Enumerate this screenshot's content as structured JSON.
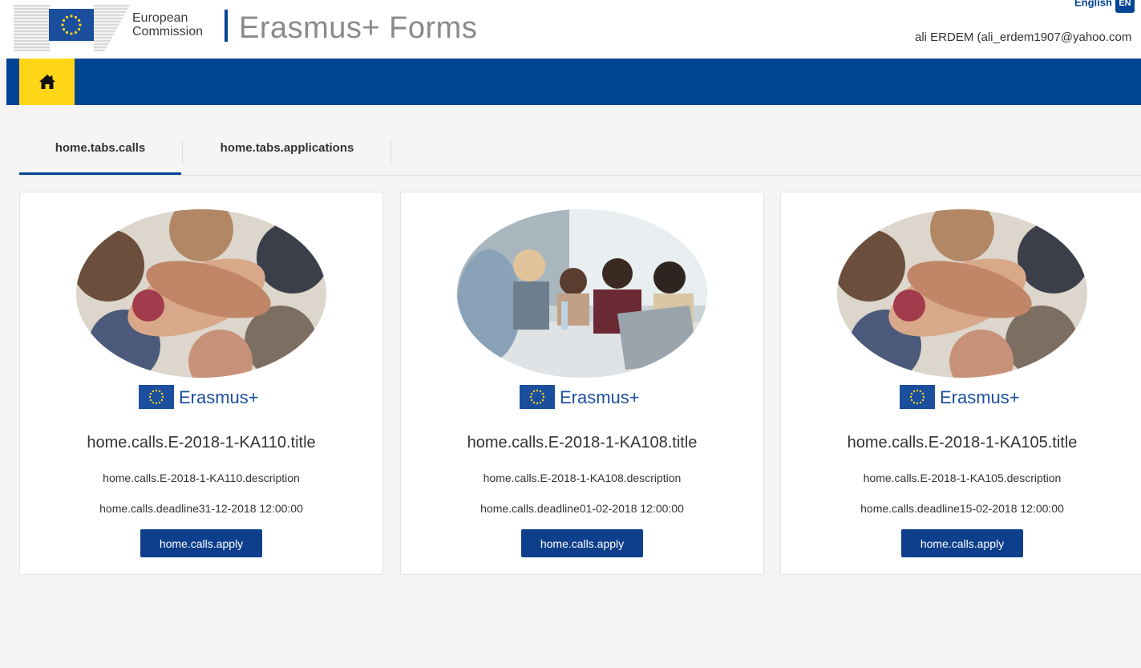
{
  "header": {
    "org_line1": "European",
    "org_line2": "Commission",
    "app_title": "Erasmus+ Forms",
    "language_label": "English",
    "language_code": "EN",
    "user": "ali ERDEM (ali_erdem1907@yahoo.com"
  },
  "nav": {
    "home_icon": "home-icon"
  },
  "tabs": [
    {
      "label": "home.tabs.calls",
      "active": true
    },
    {
      "label": "home.tabs.applications",
      "active": false
    }
  ],
  "cards": [
    {
      "image": "teamwork-hands-photo",
      "logo_text": "Erasmus+",
      "title": "home.calls.E-2018-1-KA110.title",
      "description": "home.calls.E-2018-1-KA110.description",
      "deadline": "home.calls.deadline31-12-2018 12:00:00",
      "apply_label": "home.calls.apply"
    },
    {
      "image": "students-laptop-photo",
      "logo_text": "Erasmus+",
      "title": "home.calls.E-2018-1-KA108.title",
      "description": "home.calls.E-2018-1-KA108.description",
      "deadline": "home.calls.deadline01-02-2018 12:00:00",
      "apply_label": "home.calls.apply"
    },
    {
      "image": "teamwork-hands-photo",
      "logo_text": "Erasmus+",
      "title": "home.calls.E-2018-1-KA105.title",
      "description": "home.calls.E-2018-1-KA105.description",
      "deadline": "home.calls.deadline15-02-2018 12:00:00",
      "apply_label": "home.calls.apply"
    }
  ],
  "colors": {
    "brand_blue": "#004494",
    "accent_yellow": "#ffd617",
    "button_blue": "#0e3f8c"
  }
}
